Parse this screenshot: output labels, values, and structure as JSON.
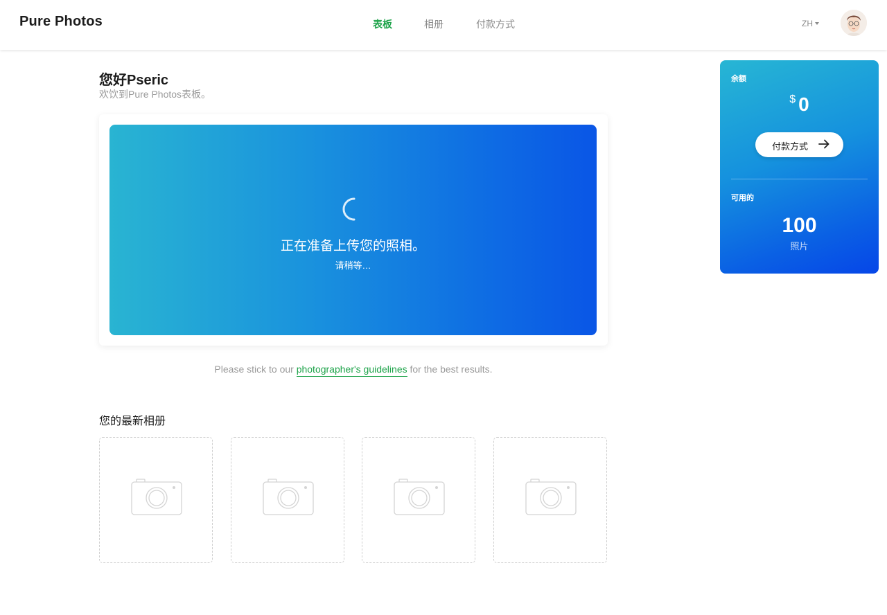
{
  "header": {
    "logo": "Pure Photos",
    "nav": [
      {
        "label": "表板",
        "active": true
      },
      {
        "label": "相册",
        "active": false
      },
      {
        "label": "付款方式",
        "active": false
      }
    ],
    "language": "ZH",
    "accent_color": "#1ea34a"
  },
  "main": {
    "greeting": "您好Pseric",
    "subtitle": "欢饮到Pure Photos表板。",
    "upload": {
      "title": "正在准备上传您的照相。",
      "subtitle": "请稍等…",
      "icon": "loading-spinner-icon"
    },
    "guideline": {
      "before": "Please stick to our ",
      "link": "photographer's guidelines",
      "after": " for the best results."
    },
    "albums": {
      "title": "您的最新相册",
      "items": [
        {
          "icon": "camera-icon"
        },
        {
          "icon": "camera-icon"
        },
        {
          "icon": "camera-icon"
        },
        {
          "icon": "camera-icon"
        }
      ]
    }
  },
  "sidebar": {
    "balance_label": "余额",
    "currency": "$",
    "balance": "0",
    "payment_button": "付款方式",
    "available_label": "可用的",
    "available_count": "100",
    "available_unit": "照片"
  }
}
